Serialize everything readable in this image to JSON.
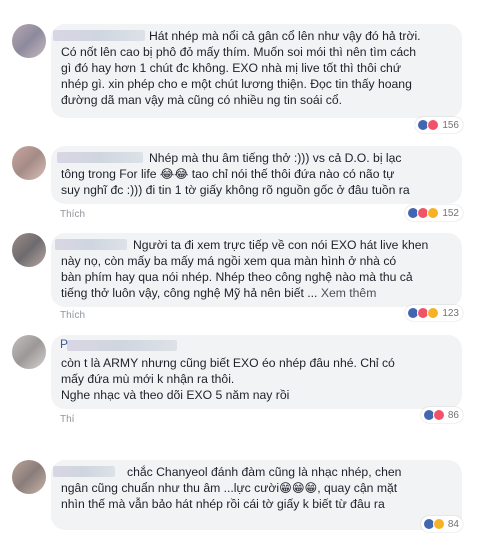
{
  "comments": [
    {
      "text": "Hát nhép mà nổi cả gân cổ lên như vậy đó hả trời.\nCó nốt lên cao bị phô đỏ mấy thím. Muốn soi mói thì nên tìm cách\ngì đó hay hơn 1 chút đc không. EXO nhà mị live tốt thì thôi chứ\nnhép gì. xin phép cho e một chút lương thiện. Đọc tin thấy hoang\nđường dã man vậy mà cũng có nhiều ng tin soái cổ.",
      "reactions": {
        "icons": [
          "like",
          "love"
        ],
        "count": "156"
      }
    },
    {
      "text": "Nhép mà thu âm tiếng thở :))) vs cả D.O. bị lạc\ntông trong For life 😂😂 tao chỉ nói thế thôi đứa nào có não tự\nsuy nghĩ đc :))) đi tin 1 tờ giấy không rõ nguồn gốc ở đâu tuồn ra",
      "reactions": {
        "icons": [
          "like",
          "love",
          "haha"
        ],
        "count": "152"
      }
    },
    {
      "text": "Người ta đi xem trực tiếp về con nói EXO hát live khen\nnày nọ, còn mấy ba mấy má ngồi xem qua màn hình ở nhà có\nbàn phím hay qua nói nhép. Nhép theo công nghệ nào mà thu cả\ntiếng thở luôn vậy, công nghệ Mỹ hả nên biết ...",
      "see_more": "Xem thêm",
      "reactions": {
        "icons": [
          "like",
          "love",
          "haha"
        ],
        "count": "123"
      }
    },
    {
      "author_initial": "P",
      "text": "còn t là ARMY nhưng cũng biết EXO éo nhép đâu nhé. Chỉ có\nmấy đứa mù mới k nhận ra thôi.\nNghe nhạc và theo dõi EXO 5 năm nay rồi",
      "reactions": {
        "icons": [
          "like",
          "love"
        ],
        "count": "86"
      }
    },
    {
      "text": "chắc Chanyeol đánh đàm cũng là nhạc nhép, chen\nngân cũng chuẩn như thu âm ...lực cười😁😁😁, quay cận mặt\nnhìn thế mà vẫn bảo hát nhép rồi cái tờ giấy k biết từ đâu ra",
      "reactions": {
        "icons": [
          "like",
          "haha"
        ],
        "count": "84"
      }
    }
  ],
  "sub_labels": [
    "Thích",
    "Thích",
    "Thí"
  ],
  "colors": {
    "like": "#4267b2",
    "love": "#f25268",
    "haha": "#f7b125",
    "text": "#1d2129",
    "bubble": "#f2f3f5"
  }
}
